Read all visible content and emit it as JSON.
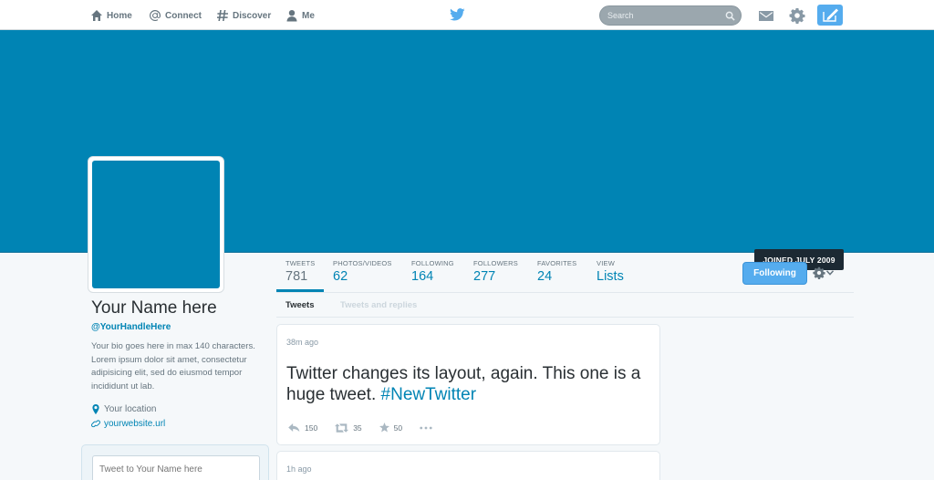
{
  "nav": {
    "home": "Home",
    "connect": "Connect",
    "discover": "Discover",
    "me": "Me",
    "search_placeholder": "Search"
  },
  "colors": {
    "brand": "#0084b4",
    "accent": "#55acee",
    "text": "#292f33",
    "muted": "#66757f"
  },
  "banner": {
    "joined_label": "JOINED JULY 2009"
  },
  "profile": {
    "name": "Your Name here",
    "handle": "@YourHandleHere",
    "bio": "Your bio goes here in max 140 characters. Lorem ipsum dolor sit amet, consectetur adipisicing elit, sed do eiusmod tempor incididunt ut lab.",
    "location": "Your location",
    "website": "yourwebsite.url",
    "tweet_to_placeholder": "Tweet to Your Name here"
  },
  "stats": [
    {
      "label": "TWEETS",
      "value": "781"
    },
    {
      "label": "PHOTOS/VIDEOS",
      "value": "62"
    },
    {
      "label": "FOLLOWING",
      "value": "164"
    },
    {
      "label": "FOLLOWERS",
      "value": "277"
    },
    {
      "label": "FAVORITES",
      "value": "24"
    },
    {
      "label": "VIEW",
      "value": "Lists"
    }
  ],
  "follow_button": "Following",
  "timeline_tabs": [
    "Tweets",
    "Tweets and replies"
  ],
  "tweets": [
    {
      "time": "38m ago",
      "text": "Twitter changes its layout, again. This one is a huge tweet.",
      "hashtag": "#NewTwitter",
      "replies": "150",
      "retweets": "35",
      "favorites": "50"
    },
    {
      "time": "1h ago"
    }
  ]
}
